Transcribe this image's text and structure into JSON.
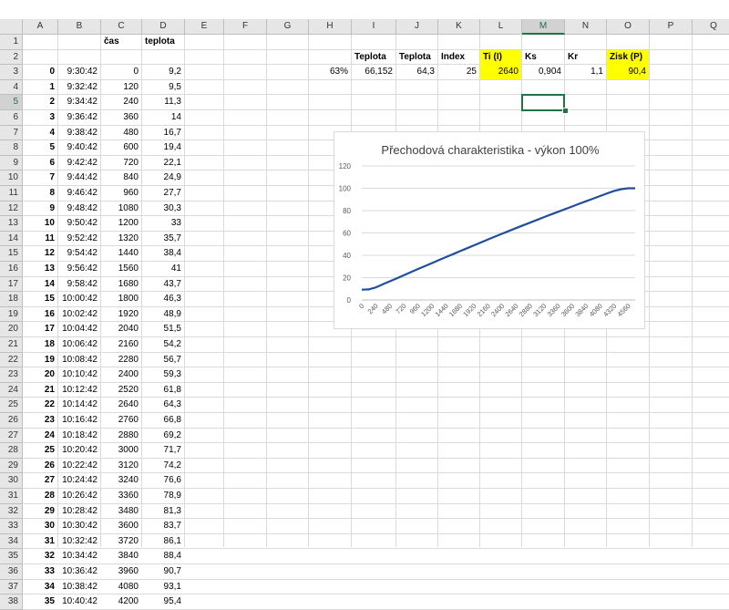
{
  "columns": [
    "A",
    "B",
    "C",
    "D",
    "E",
    "F",
    "G",
    "H",
    "I",
    "J",
    "K",
    "L",
    "M",
    "N",
    "O",
    "P",
    "Q"
  ],
  "selected_column": "M",
  "selected_row": 5,
  "header_row": {
    "C1": "čas",
    "D1": "teplota"
  },
  "params": {
    "labels": {
      "I2": "Teplota",
      "J2": "Teplota",
      "K2": "Index",
      "L2": "Ti (I)",
      "M2": "Ks",
      "N2": "Kr",
      "O2": "Zisk (P)"
    },
    "values": {
      "H3": "63%",
      "I3": "66,152",
      "J3": "64,3",
      "K3": "25",
      "L3": "2640",
      "M3": "0,904",
      "N3": "1,1",
      "O3": "90,4"
    },
    "highlight_color": "#ffff00"
  },
  "rows": [
    {
      "a": "0",
      "b": "9:30:42",
      "c": "0",
      "d": "9,2"
    },
    {
      "a": "1",
      "b": "9:32:42",
      "c": "120",
      "d": "9,5"
    },
    {
      "a": "2",
      "b": "9:34:42",
      "c": "240",
      "d": "11,3"
    },
    {
      "a": "3",
      "b": "9:36:42",
      "c": "360",
      "d": "14"
    },
    {
      "a": "4",
      "b": "9:38:42",
      "c": "480",
      "d": "16,7"
    },
    {
      "a": "5",
      "b": "9:40:42",
      "c": "600",
      "d": "19,4"
    },
    {
      "a": "6",
      "b": "9:42:42",
      "c": "720",
      "d": "22,1"
    },
    {
      "a": "7",
      "b": "9:44:42",
      "c": "840",
      "d": "24,9"
    },
    {
      "a": "8",
      "b": "9:46:42",
      "c": "960",
      "d": "27,7"
    },
    {
      "a": "9",
      "b": "9:48:42",
      "c": "1080",
      "d": "30,3"
    },
    {
      "a": "10",
      "b": "9:50:42",
      "c": "1200",
      "d": "33"
    },
    {
      "a": "11",
      "b": "9:52:42",
      "c": "1320",
      "d": "35,7"
    },
    {
      "a": "12",
      "b": "9:54:42",
      "c": "1440",
      "d": "38,4"
    },
    {
      "a": "13",
      "b": "9:56:42",
      "c": "1560",
      "d": "41"
    },
    {
      "a": "14",
      "b": "9:58:42",
      "c": "1680",
      "d": "43,7"
    },
    {
      "a": "15",
      "b": "10:00:42",
      "c": "1800",
      "d": "46,3"
    },
    {
      "a": "16",
      "b": "10:02:42",
      "c": "1920",
      "d": "48,9"
    },
    {
      "a": "17",
      "b": "10:04:42",
      "c": "2040",
      "d": "51,5"
    },
    {
      "a": "18",
      "b": "10:06:42",
      "c": "2160",
      "d": "54,2"
    },
    {
      "a": "19",
      "b": "10:08:42",
      "c": "2280",
      "d": "56,7"
    },
    {
      "a": "20",
      "b": "10:10:42",
      "c": "2400",
      "d": "59,3"
    },
    {
      "a": "21",
      "b": "10:12:42",
      "c": "2520",
      "d": "61,8"
    },
    {
      "a": "22",
      "b": "10:14:42",
      "c": "2640",
      "d": "64,3"
    },
    {
      "a": "23",
      "b": "10:16:42",
      "c": "2760",
      "d": "66,8"
    },
    {
      "a": "24",
      "b": "10:18:42",
      "c": "2880",
      "d": "69,2"
    },
    {
      "a": "25",
      "b": "10:20:42",
      "c": "3000",
      "d": "71,7"
    },
    {
      "a": "26",
      "b": "10:22:42",
      "c": "3120",
      "d": "74,2"
    },
    {
      "a": "27",
      "b": "10:24:42",
      "c": "3240",
      "d": "76,6"
    },
    {
      "a": "28",
      "b": "10:26:42",
      "c": "3360",
      "d": "78,9"
    },
    {
      "a": "29",
      "b": "10:28:42",
      "c": "3480",
      "d": "81,3"
    },
    {
      "a": "30",
      "b": "10:30:42",
      "c": "3600",
      "d": "83,7"
    },
    {
      "a": "31",
      "b": "10:32:42",
      "c": "3720",
      "d": "86,1"
    },
    {
      "a": "32",
      "b": "10:34:42",
      "c": "3840",
      "d": "88,4"
    },
    {
      "a": "33",
      "b": "10:36:42",
      "c": "3960",
      "d": "90,7"
    },
    {
      "a": "34",
      "b": "10:38:42",
      "c": "4080",
      "d": "93,1"
    },
    {
      "a": "35",
      "b": "10:40:42",
      "c": "4200",
      "d": "95,4"
    }
  ],
  "chart_data": {
    "type": "line",
    "title": "Přechodová charakteristika - výkon 100%",
    "xlabel": "",
    "ylabel": "",
    "ylim": [
      0,
      120
    ],
    "yticks": [
      "0",
      "20",
      "40",
      "60",
      "80",
      "100",
      "120"
    ],
    "categories": [
      "0",
      "240",
      "480",
      "720",
      "960",
      "1200",
      "1440",
      "1680",
      "1920",
      "2160",
      "2400",
      "2640",
      "2880",
      "3120",
      "3360",
      "3600",
      "3840",
      "4080",
      "4320",
      "4560"
    ],
    "x": [
      0,
      120,
      240,
      360,
      480,
      600,
      720,
      840,
      960,
      1080,
      1200,
      1320,
      1440,
      1560,
      1680,
      1800,
      1920,
      2040,
      2160,
      2280,
      2400,
      2520,
      2640,
      2760,
      2880,
      3000,
      3120,
      3240,
      3360,
      3480,
      3600,
      3720,
      3840,
      3960,
      4080,
      4200,
      4320,
      4440,
      4560,
      4680
    ],
    "values": [
      9.2,
      9.5,
      11.3,
      14,
      16.7,
      19.4,
      22.1,
      24.9,
      27.7,
      30.3,
      33,
      35.7,
      38.4,
      41,
      43.7,
      46.3,
      48.9,
      51.5,
      54.2,
      56.7,
      59.3,
      61.8,
      64.3,
      66.8,
      69.2,
      71.7,
      74.2,
      76.6,
      78.9,
      81.3,
      83.7,
      86.1,
      88.4,
      90.7,
      93.1,
      95.4,
      97.6,
      99.2,
      100,
      100
    ],
    "line_color": "#1f4e9c",
    "grid": true
  }
}
